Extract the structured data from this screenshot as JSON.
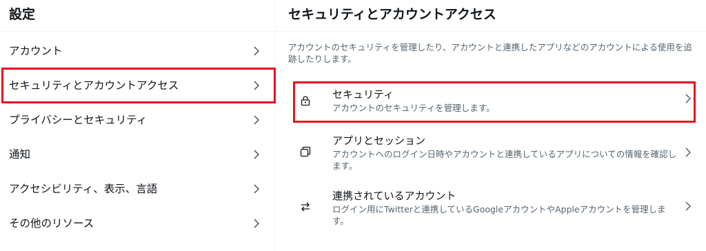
{
  "sidebar": {
    "title": "設定",
    "items": [
      {
        "label": "アカウント"
      },
      {
        "label": "セキュリティとアカウントアクセス"
      },
      {
        "label": "プライバシーとセキュリティ"
      },
      {
        "label": "通知"
      },
      {
        "label": "アクセシビリティ、表示、言語"
      },
      {
        "label": "その他のリソース"
      }
    ],
    "selected_index": 1
  },
  "main": {
    "title": "セキュリティとアカウントアクセス",
    "description": "アカウントのセキュリティを管理したり、アカウントと連携したアプリなどのアカウントによる使用を追跡したりします。",
    "options": [
      {
        "icon": "lock-icon",
        "title": "セキュリティ",
        "subtitle": "アカウントのセキュリティを管理します。"
      },
      {
        "icon": "copy-icon",
        "title": "アプリとセッション",
        "subtitle": "アカウントへのログイン日時やアカウントと連携しているアプリについての情報を確認します。"
      },
      {
        "icon": "swap-arrows-icon",
        "title": "連携されているアカウント",
        "subtitle": "ログイン用にTwitterと連携しているGoogleアカウントやAppleアカウントを管理します。"
      }
    ]
  },
  "colors": {
    "highlight": "#e5101f",
    "text": "#0f1419",
    "secondary_text": "#536471",
    "divider": "#eff3f4"
  }
}
